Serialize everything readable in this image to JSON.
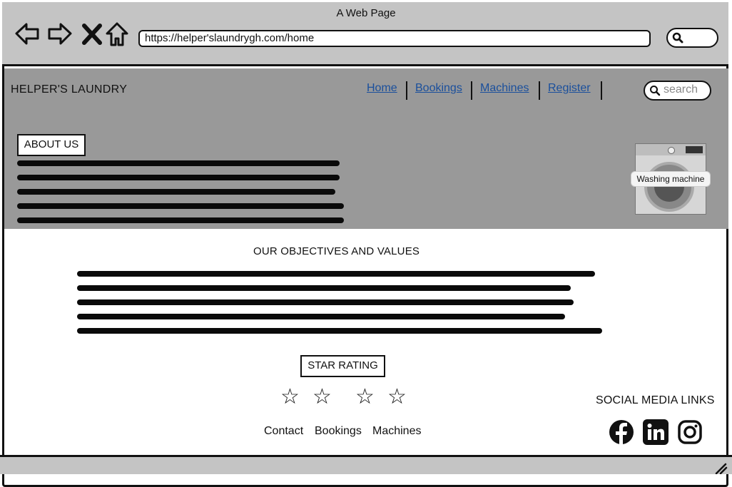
{
  "window": {
    "title": "A Web Page"
  },
  "browser": {
    "url": "https://helper'slaundrygh.com/home"
  },
  "header": {
    "brand": "HELPER'S LAUNDRY",
    "nav": [
      {
        "label": "Home"
      },
      {
        "label": "Bookings"
      },
      {
        "label": "Machines"
      },
      {
        "label": "Register"
      }
    ],
    "search_placeholder": "search"
  },
  "about": {
    "label": "ABOUT US"
  },
  "hero_image": {
    "caption": "Washing machine",
    "icon": "washing-machine-image"
  },
  "objectives": {
    "title": "OUR OBJECTIVES AND VALUES"
  },
  "rating": {
    "label": "STAR RATING",
    "stars_total": 4,
    "stars_filled": 0
  },
  "footer": {
    "links": [
      {
        "label": "Contact"
      },
      {
        "label": "Bookings"
      },
      {
        "label": "Machines"
      }
    ],
    "social_title": "SOCIAL MEDIA LINKS",
    "social": [
      {
        "name": "facebook-icon"
      },
      {
        "name": "linkedin-icon"
      },
      {
        "name": "instagram-icon"
      }
    ]
  },
  "colors": {
    "header_bg": "#999999",
    "chrome_bg": "#c4c4c4",
    "link": "#1a4f9c"
  }
}
